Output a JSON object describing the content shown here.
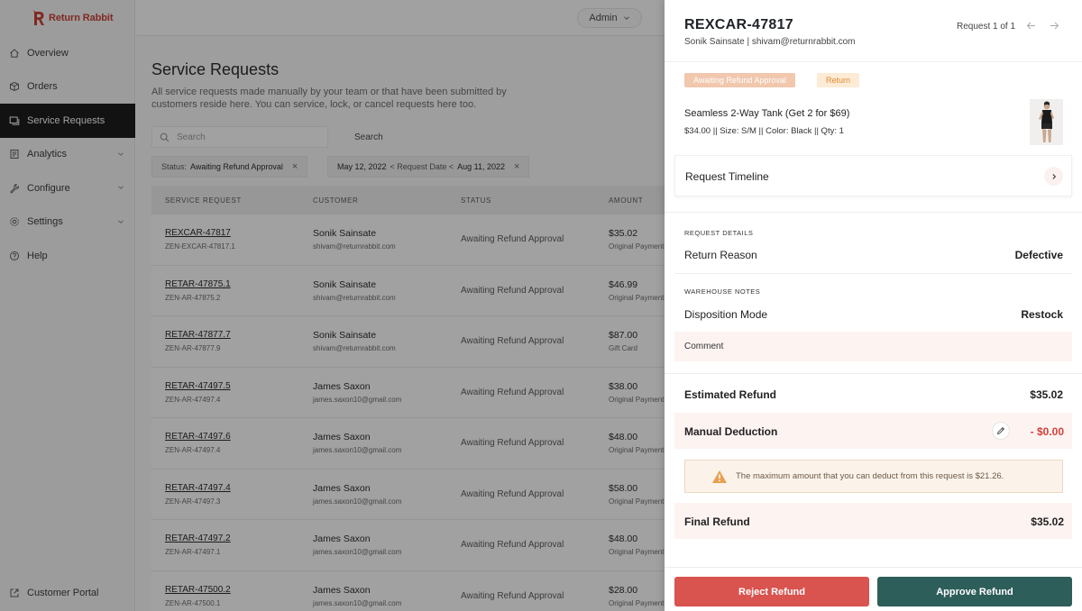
{
  "app": {
    "brand": "Return Rabbit"
  },
  "sidebar": {
    "items": [
      {
        "label": "Overview",
        "icon": "home-icon",
        "has_chevron": false,
        "active": false
      },
      {
        "label": "Orders",
        "icon": "box-icon",
        "has_chevron": false,
        "active": false
      },
      {
        "label": "Service Requests",
        "icon": "requests-icon",
        "has_chevron": false,
        "active": true
      },
      {
        "label": "Analytics",
        "icon": "analytics-icon",
        "has_chevron": true,
        "active": false
      },
      {
        "label": "Configure",
        "icon": "wrench-icon",
        "has_chevron": true,
        "active": false
      },
      {
        "label": "Settings",
        "icon": "gear-icon",
        "has_chevron": true,
        "active": false
      },
      {
        "label": "Help",
        "icon": "help-icon",
        "has_chevron": false,
        "active": false
      }
    ],
    "portal": "Customer Portal"
  },
  "header": {
    "admin_label": "Admin"
  },
  "page": {
    "title": "Service Requests",
    "description": "All service requests made manually by your team or that have been submitted by customers reside here. You can service, lock, or cancel requests here too.",
    "search_placeholder": "Search",
    "search_button": "Search",
    "filters": {
      "status_key": "Status:",
      "status_value": "Awaiting Refund Approval",
      "date_from": "May 12, 2022",
      "date_mid": "< Request Date <",
      "date_to": "Aug 11, 2022"
    }
  },
  "table": {
    "columns": [
      "SERVICE REQUEST",
      "CUSTOMER",
      "STATUS",
      "AMOUNT"
    ],
    "rows": [
      {
        "id": "REXCAR-47817",
        "sub": "ZEN-EXCAR-47817.1",
        "customer": "Sonik Sainsate",
        "email": "shivam@returnrabbit.com",
        "status": "Awaiting Refund Approval",
        "amount": "$35.02",
        "amount_note": "Original Payment"
      },
      {
        "id": "RETAR-47875.1",
        "sub": "ZEN-AR-47875.2",
        "customer": "Sonik Sainsate",
        "email": "shivam@returnrabbit.com",
        "status": "Awaiting Refund Approval",
        "amount": "$46.99",
        "amount_note": "Original Payment"
      },
      {
        "id": "RETAR-47877.7",
        "sub": "ZEN-AR-47877.9",
        "customer": "Sonik Sainsate",
        "email": "shivam@returnrabbit.com",
        "status": "Awaiting Refund Approval",
        "amount": "$87.00",
        "amount_note": "Gift Card"
      },
      {
        "id": "RETAR-47497.5",
        "sub": "ZEN-AR-47497.4",
        "customer": "James Saxon",
        "email": "james.saxon10@gmail.com",
        "status": "Awaiting Refund Approval",
        "amount": "$38.00",
        "amount_note": "Original Payment"
      },
      {
        "id": "RETAR-47497.6",
        "sub": "ZEN-AR-47497.4",
        "customer": "James Saxon",
        "email": "james.saxon10@gmail.com",
        "status": "Awaiting Refund Approval",
        "amount": "$48.00",
        "amount_note": "Original Payment"
      },
      {
        "id": "RETAR-47497.4",
        "sub": "ZEN-AR-47497.3",
        "customer": "James Saxon",
        "email": "james.saxon10@gmail.com",
        "status": "Awaiting Refund Approval",
        "amount": "$58.00",
        "amount_note": "Original Payment"
      },
      {
        "id": "RETAR-47497.2",
        "sub": "ZEN-AR-47497.1",
        "customer": "James Saxon",
        "email": "james.saxon10@gmail.com",
        "status": "Awaiting Refund Approval",
        "amount": "$48.00",
        "amount_note": "Original Payment"
      },
      {
        "id": "RETAR-47500.2",
        "sub": "ZEN-AR-47500.1",
        "customer": "James Saxon",
        "email": "james.saxon10@gmail.com",
        "status": "Awaiting Refund Approval",
        "amount": "$28.00",
        "amount_note": "Original Payment"
      }
    ]
  },
  "drawer": {
    "title": "REXCAR-47817",
    "subtitle": "Sonik Sainsate | shivam@returnrabbit.com",
    "pager": "Request 1 of 1",
    "badge_status": "Awaiting Refund Approval",
    "badge_type": "Return",
    "product_name": "Seamless 2-Way Tank (Get 2 for $69)",
    "product_meta": "$34.00 || Size: S/M || Color: Black || Qty: 1",
    "timeline_label": "Request Timeline",
    "request_details_heading": "REQUEST DETAILS",
    "return_reason_label": "Return Reason",
    "return_reason_value": "Defective",
    "warehouse_heading": "WAREHOUSE NOTES",
    "disposition_label": "Disposition Mode",
    "disposition_value": "Restock",
    "comment_label": "Comment",
    "estimated_label": "Estimated Refund",
    "estimated_value": "$35.02",
    "deduction_label": "Manual Deduction",
    "deduction_value": "- $0.00",
    "warning": "The maximum amount that you can deduct from this request is $21.26.",
    "final_label": "Final Refund",
    "final_value": "$35.02",
    "reject_label": "Reject Refund",
    "approve_label": "Approve Refund"
  },
  "colors": {
    "brand": "#c8372d",
    "reject": "#d9534f",
    "approve": "#2e5e5a",
    "deduction": "#d2413b"
  }
}
